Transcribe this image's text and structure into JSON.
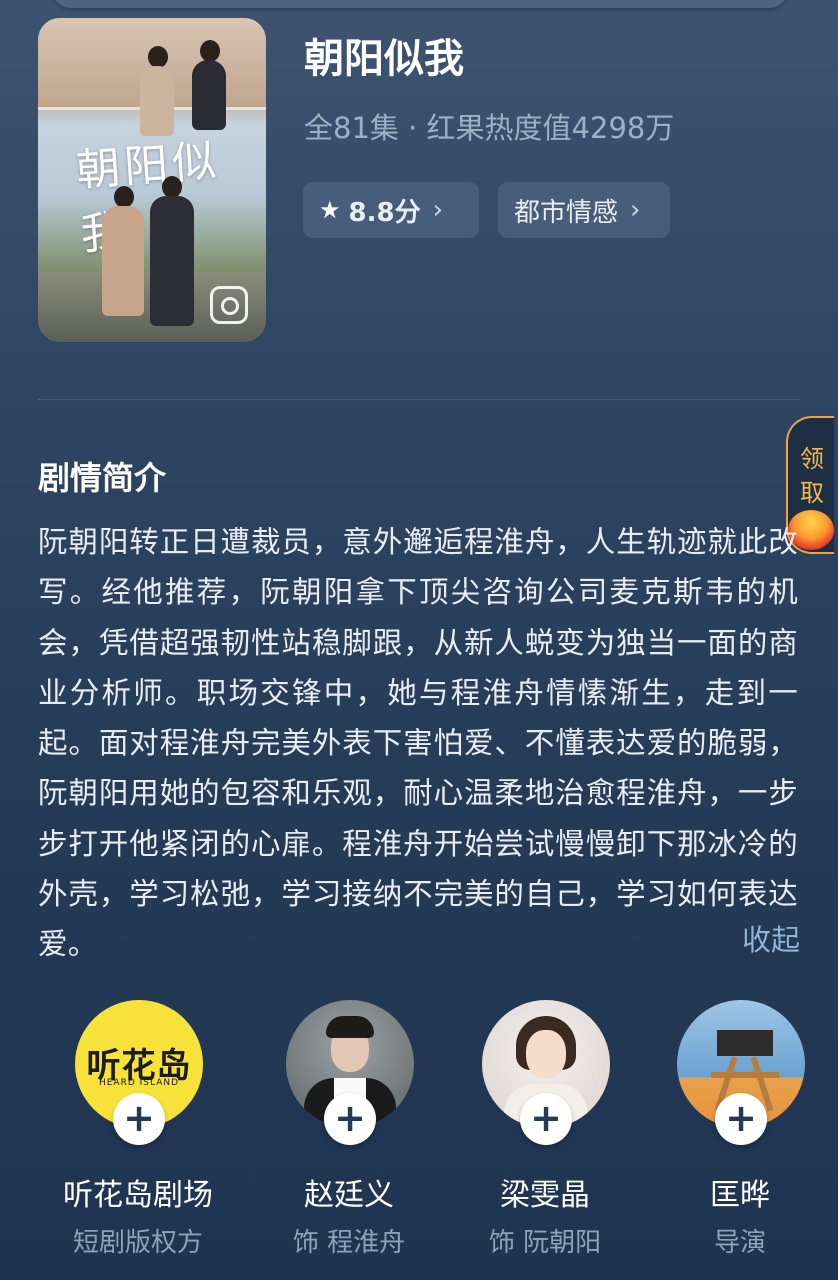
{
  "show": {
    "title": "朝阳似我",
    "meta": "全81集 · 红果热度值4298万",
    "poster_title": "朝阳似我",
    "rating_label": "8.8分",
    "genre_label": "都市情感"
  },
  "icons": {
    "rating": "star-icon",
    "chevron": "chevron-right-icon",
    "save": "save-image-icon",
    "add": "plus-icon"
  },
  "reward": {
    "label_1": "领",
    "label_2": "取"
  },
  "synopsis": {
    "heading": "剧情简介",
    "text": "阮朝阳转正日遭裁员，意外邂逅程淮舟，人生轨迹就此改写。经他推荐，阮朝阳拿下顶尖咨询公司麦克斯韦的机会，凭借超强韧性站稳脚跟，从新人蜕变为独当一面的商业分析师。职场交锋中，她与程淮舟情愫渐生，走到一起。面对程淮舟完美外表下害怕爱、不懂表达爱的脆弱，阮朝阳用她的包容和乐观，耐心温柔地治愈程淮舟，一步步打开他紧闭的心扉。程淮舟开始尝试慢慢卸下那冰冷的外壳，学习松弛，学习接纳不完美的自己，学习如何表达爱。",
    "collapse_label": "收起"
  },
  "people": [
    {
      "name": "听花岛剧场",
      "role": "短剧版权方",
      "logo_text": "听花岛",
      "logo_sub": "HEARD ISLAND",
      "add_label": "+"
    },
    {
      "name": "赵廷义",
      "role": "饰 程淮舟",
      "add_label": "+"
    },
    {
      "name": "梁雯晶",
      "role": "饰 阮朝阳",
      "add_label": "+"
    },
    {
      "name": "匡晔",
      "role": "导演",
      "add_label": "+"
    }
  ],
  "colors": {
    "background_top": "#3d5470",
    "background_bottom": "#1f3450",
    "chip_bg": "#475d79",
    "meta_text": "#9eb0c3",
    "link_blue": "#8fb2d6",
    "reward_orange": "#f5b947",
    "logo_yellow": "#f7e23a"
  }
}
